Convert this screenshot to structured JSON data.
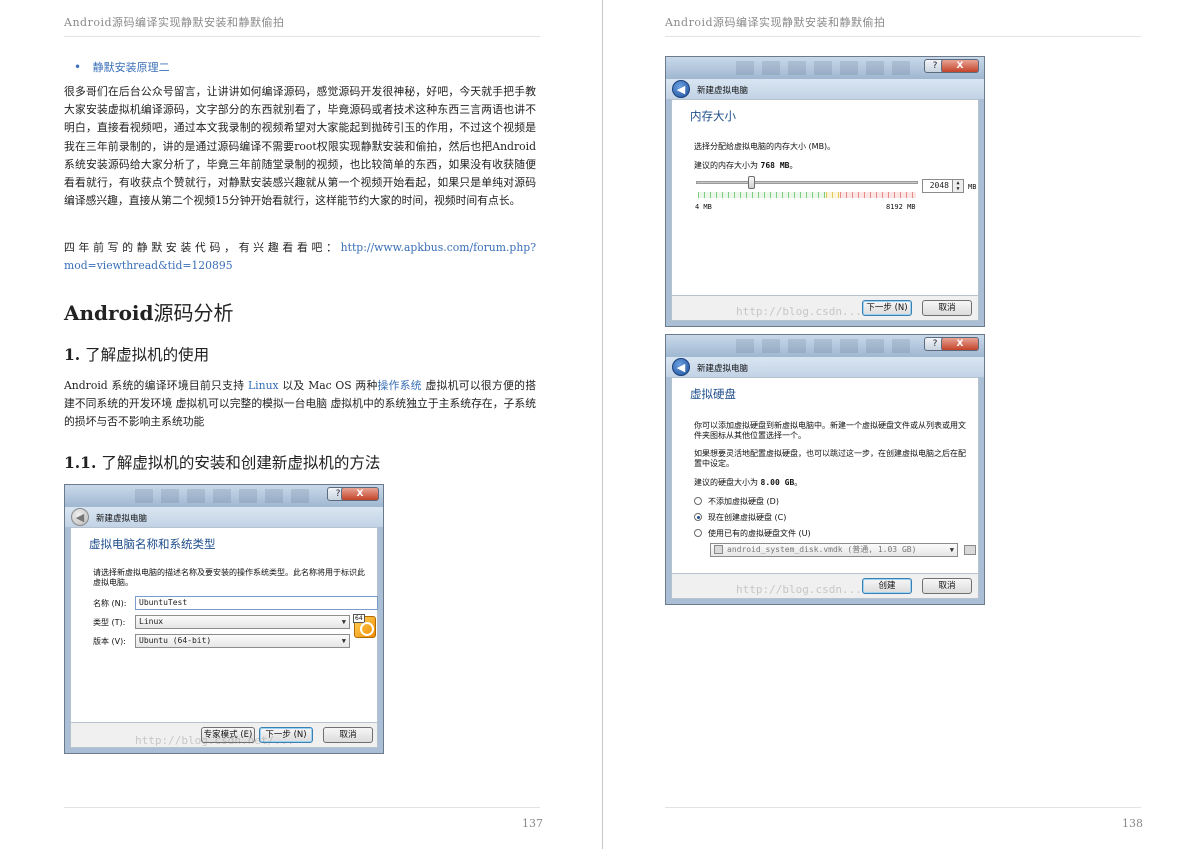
{
  "running_header": "Android源码编译实现静默安装和静默偷拍",
  "left_page": {
    "number": "137",
    "bullet_link": "静默安装原理二",
    "intro_paragraph": "很多哥们在后台公众号留言，让讲讲如何编译源码，感觉源码开发很神秘，好吧，今天就手把手教大家安装虚拟机编译源码，文字部分的东西就别看了，毕竟源码或者技术这种东西三言两语也讲不明白，直接看视频吧，通过本文我录制的视频希望对大家能起到抛砖引玉的作用，不过这个视频是我在三年前录制的，讲的是通过源码编译不需要root权限实现静默安装和偷拍，然后也把Android系统安装源码给大家分析了，毕竟三年前随堂录制的视频，也比较简单的东西，如果没有收获随便看看就行，有收获点个赞就行，对静默安装感兴趣就从第一个视频开始看起，如果只是单纯对源码编译感兴趣，直接从第二个视频15分钟开始看就行，这样能节约大家的时间，视频时间有点长。",
    "code_intro": "四年前写的静默安装代码，有兴趣看看吧：",
    "code_link": "http://www.apkbus.com/forum.php?mod=viewthread&tid=120895",
    "h1_latin": "Android",
    "h1_cn": "源码分析",
    "h2_num": "1.",
    "h2_text": "了解虚拟机的使用",
    "env_para_p1": "Android 系统的编译环境目前只支持 ",
    "env_para_linux": "Linux",
    "env_para_p2": " 以及 Mac OS 两种",
    "env_para_os": "操作系统",
    "env_para_p3": " 虚拟机可以很方便的搭建不同系统的开发环境 虚拟机可以完整的模拟一台电脑 虚拟机中的系统独立于主系统存在，子系统的损坏与否不影响主系统功能",
    "h3_num": "1.1.",
    "h3_text": "了解虚拟机的安装和创建新虚拟机的方法"
  },
  "right_page": {
    "number": "138"
  },
  "dialog_name": {
    "window_title": "新建虚拟电脑",
    "heading": "虚拟电脑名称和系统类型",
    "description": "请选择新虚拟电脑的描述名称及要安装的操作系统类型。此名称将用于标识此虚拟电脑。",
    "name_label": "名称 (N):",
    "name_value": "UbuntuTest",
    "type_label": "类型 (T):",
    "type_value": "Linux",
    "version_label": "版本 (V):",
    "version_value": "Ubuntu (64-bit)",
    "os_badge": "64",
    "expert_button": "专家模式 (E)",
    "next_button": "下一步 (N)",
    "cancel_button": "取消",
    "help_button": "?",
    "close_button": "X",
    "watermark": "http://blog.csdn.net/..."
  },
  "dialog_memory": {
    "window_title": "新建虚拟电脑",
    "heading": "内存大小",
    "description": "选择分配给虚拟电脑的内存大小 (MB)。",
    "recommend_prefix": "建议的内存大小为 ",
    "recommend_value": "768 MB",
    "recommend_suffix": "。",
    "memory_value": "2048",
    "unit": "MB",
    "slider_min": "4 MB",
    "slider_max": "8192 MB",
    "slider_fraction": 0.25,
    "next_button": "下一步 (N)",
    "cancel_button": "取消",
    "help_button": "?",
    "close_button": "X",
    "watermark": "http://blog.csdn..."
  },
  "dialog_disk": {
    "window_title": "新建虚拟电脑",
    "heading": "虚拟硬盘",
    "description": "你可以添加虚拟硬盘到新虚拟电脑中。新建一个虚拟硬盘文件或从列表或用文件夹图标从其他位置选择一个。",
    "description2": "如果想要灵活地配置虚拟硬盘，也可以跳过这一步，在创建虚拟电脑之后在配置中设定。",
    "recommend_prefix": "建议的硬盘大小为 ",
    "recommend_value": "8.00 GB",
    "recommend_suffix": "。",
    "option_none": "不添加虚拟硬盘 (D)",
    "option_create": "现在创建虚拟硬盘 (C)",
    "option_existing": "使用已有的虚拟硬盘文件 (U)",
    "selected_option": "option_create",
    "existing_file": "android_system_disk.vmdk (普通, 1.03 GB)",
    "create_button": "创建",
    "cancel_button": "取消",
    "help_button": "?",
    "close_button": "X",
    "watermark": "http://blog.csdn..."
  }
}
